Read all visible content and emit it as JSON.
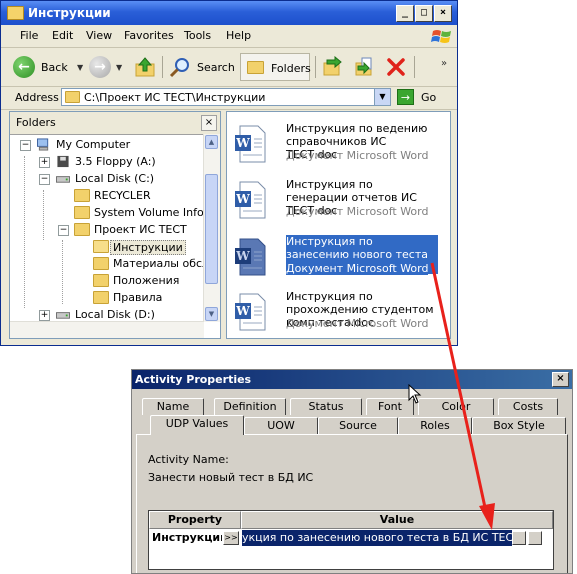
{
  "explorer": {
    "title": "Инструкции",
    "menu": [
      "File",
      "Edit",
      "View",
      "Favorites",
      "Tools",
      "Help"
    ],
    "toolbar": {
      "back": "Back",
      "search": "Search",
      "folders": "Folders"
    },
    "address": {
      "label": "Address",
      "value": "C:\\Проект ИС ТЕСТ\\Инструкции",
      "go": "Go"
    },
    "folders_pane": {
      "title": "Folders",
      "tree": [
        {
          "label": "My Computer",
          "icon": "computer-icon",
          "expander": "−"
        },
        {
          "label": "3.5 Floppy (A:)",
          "icon": "floppy-icon",
          "expander": "+"
        },
        {
          "label": "Local Disk (C:)",
          "icon": "drive-icon",
          "expander": "−"
        },
        {
          "label": "RECYCLER",
          "icon": "folder-icon",
          "expander": ""
        },
        {
          "label": "System Volume Informa",
          "icon": "folder-icon",
          "expander": ""
        },
        {
          "label": "Проект ИС ТЕСТ",
          "icon": "folder-icon",
          "expander": "−"
        },
        {
          "label": "Инструкции",
          "icon": "folder-open-icon",
          "expander": "",
          "selected": true
        },
        {
          "label": "Материалы обсле,",
          "icon": "folder-icon",
          "expander": ""
        },
        {
          "label": "Положения",
          "icon": "folder-icon",
          "expander": ""
        },
        {
          "label": "Правила",
          "icon": "folder-icon",
          "expander": ""
        },
        {
          "label": "Local Disk (D:)",
          "icon": "drive-icon",
          "expander": "+"
        }
      ]
    },
    "files": [
      {
        "name": "Инструкция по ведению справочников ИС ТЕСТ.doc",
        "type": "Документ Microsoft Word",
        "selected": false
      },
      {
        "name": "Инструкция по генерации отчетов ИС ТЕСТ.doc",
        "type": "Документ Microsoft Word",
        "selected": false
      },
      {
        "name": "Инструкция по занесению нового теста в БД ИС Т...",
        "type": "Документ Microsoft Word",
        "selected": true
      },
      {
        "name": "Инструкция по прохождению студентом комп теста.doc",
        "type": "Документ Microsoft Word",
        "selected": false
      }
    ]
  },
  "dialog": {
    "title": "Activity Properties",
    "tabs_back": [
      "Name",
      "Definition",
      "Status",
      "Font",
      "Color",
      "Costs"
    ],
    "tabs_front": [
      "UDP Values",
      "UOW",
      "Source",
      "Roles",
      "Box Style"
    ],
    "active_tab": "UDP Values",
    "activity_name_label": "Activity Name:",
    "activity_name_value": "Занести новый тест в БД ИС",
    "grid": {
      "headers": [
        "Property",
        "Value"
      ],
      "row": {
        "property": "Инструкции",
        "expand": ">>",
        "value": "укция по занесению нового теста в БД ИС ТЕСТ.doc"
      }
    }
  },
  "colors": {
    "arrow": "#e8211b",
    "selection": "#316ac5",
    "title_blue": "#2a5fd8"
  }
}
